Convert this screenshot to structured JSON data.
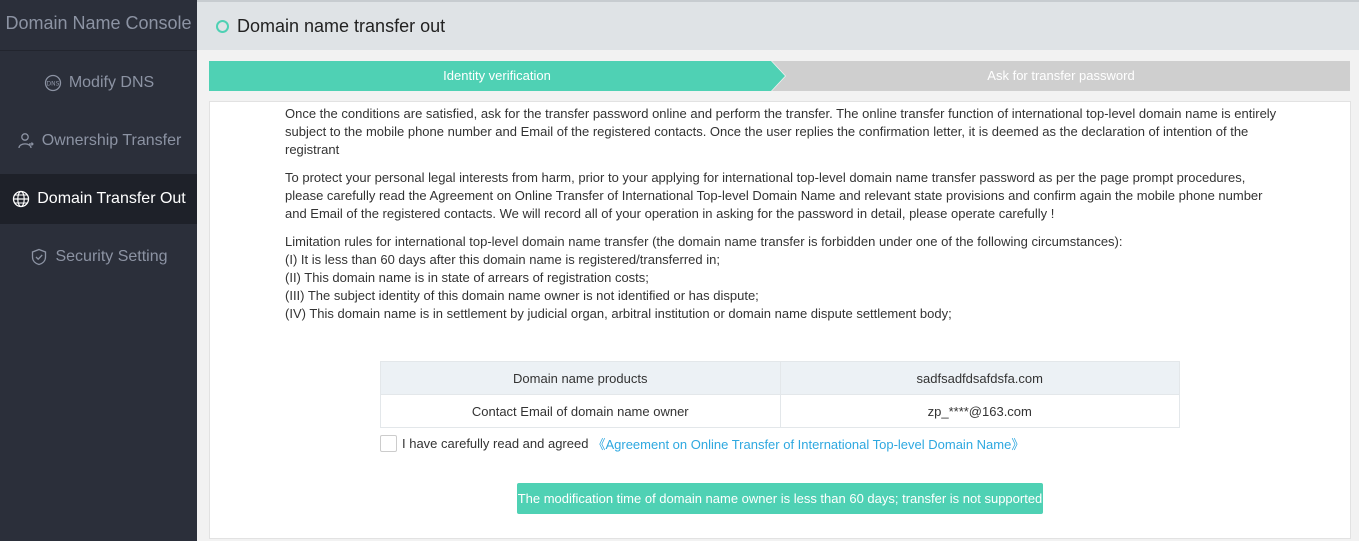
{
  "sidebar": {
    "title": "Domain Name Console",
    "items": [
      {
        "label": "Modify DNS",
        "icon": "dns-icon"
      },
      {
        "label": "Ownership Transfer",
        "icon": "user-transfer-icon"
      },
      {
        "label": "Domain Transfer Out",
        "icon": "globe-icon",
        "active": true
      },
      {
        "label": "Security Setting",
        "icon": "shield-check-icon"
      }
    ]
  },
  "header": {
    "title": "Domain name transfer out"
  },
  "steps": [
    {
      "label": "Identity verification",
      "active": true
    },
    {
      "label": "Ask for transfer password",
      "active": false
    }
  ],
  "content": {
    "p1": "Once the conditions are satisfied, ask for the transfer password online and perform the transfer. The online transfer function of international top-level domain name is entirely subject to the mobile phone number and Email of the registered contacts. Once the user replies the confirmation letter, it is deemed as the declaration of intention of the registrant",
    "p2": "To protect your personal legal interests from harm, prior to your applying for international top-level domain name transfer password as per the page prompt procedures, please carefully read the Agreement on Online Transfer of International Top-level Domain Name and relevant state provisions and confirm again the mobile phone number and Email of the registered contacts. We will record all of your operation in asking for the password in detail, please operate carefully !",
    "rules_intro": "Limitation rules for international top-level domain name transfer (the domain name transfer is forbidden under one of the following circumstances):",
    "rules": [
      "(I) It is less than 60 days after this domain name is registered/transferred in;",
      "(II) This domain name is in state of arrears of registration costs;",
      "(III) The subject identity of this domain name owner is not identified or has dispute;",
      "(IV) This domain name is in settlement by judicial organ, arbitral institution or domain name dispute settlement body;"
    ]
  },
  "table": {
    "rows": [
      {
        "label": "Domain name products",
        "value": "sadfsadfdsafdsfa.com"
      },
      {
        "label": "Contact Email of domain name owner",
        "value": "zp_****@163.com"
      }
    ]
  },
  "agreement": {
    "checked": false,
    "text": "I have carefully read and agreed",
    "link": "《Agreement on Online Transfer of International Top-level Domain Name》"
  },
  "notice_button": "The modification time of domain name owner is less than 60 days; transfer is not supported",
  "colors": {
    "accent": "#4fd1b4",
    "sidebar_bg": "#2b2f3a",
    "link": "#2ea8e0"
  }
}
